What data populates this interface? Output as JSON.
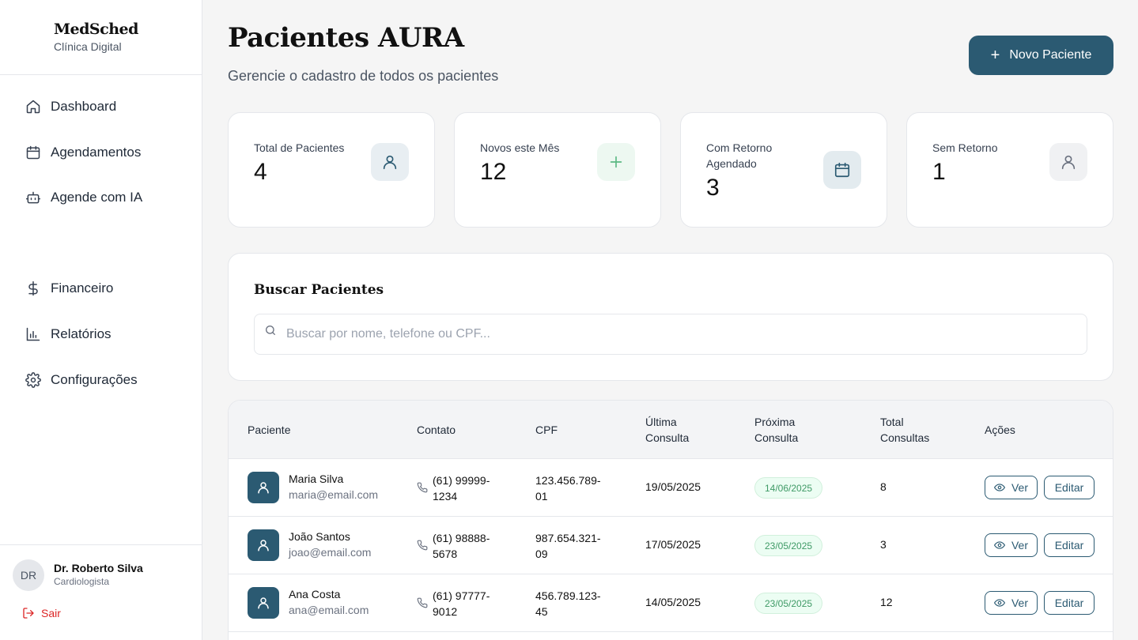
{
  "brand": {
    "name": "MedSched",
    "subtitle": "Clínica Digital"
  },
  "nav": {
    "items": [
      {
        "label": "Dashboard",
        "icon": "home-icon"
      },
      {
        "label": "Agendamentos",
        "icon": "calendar-icon"
      },
      {
        "label": "Agende com IA",
        "icon": "bot-icon"
      },
      {
        "label": "Financeiro",
        "icon": "dollar-icon"
      },
      {
        "label": "Relatórios",
        "icon": "bar-chart-icon"
      },
      {
        "label": "Configurações",
        "icon": "gear-icon"
      }
    ]
  },
  "user": {
    "initials": "DR",
    "name": "Dr. Roberto Silva",
    "role": "Cardiologista",
    "logout": "Sair"
  },
  "header": {
    "title": "Pacientes AURA",
    "subtitle": "Gerencie o cadastro de todos os pacientes",
    "new_button": "Novo Paciente"
  },
  "stats": [
    {
      "label": "Total de Pacientes",
      "value": "4",
      "icon": "user-icon"
    },
    {
      "label": "Novos este Mês",
      "value": "12",
      "icon": "plus-icon"
    },
    {
      "label": "Com Retorno Agendado",
      "value": "3",
      "icon": "calendar-icon"
    },
    {
      "label": "Sem Retorno",
      "value": "1",
      "icon": "user-icon"
    }
  ],
  "search": {
    "title": "Buscar Pacientes",
    "placeholder": "Buscar por nome, telefone ou CPF..."
  },
  "table": {
    "headers": {
      "paciente": "Paciente",
      "contato": "Contato",
      "cpf": "CPF",
      "ultima_1": "Última",
      "ultima_2": "Consulta",
      "proxima_1": "Próxima",
      "proxima_2": "Consulta",
      "total_1": "Total",
      "total_2": "Consultas",
      "acoes": "Ações"
    },
    "ver_label": "Ver",
    "edit_label": "Editar",
    "rows": [
      {
        "name": "Maria Silva",
        "email": "maria@email.com",
        "phone": "(61) 99999-1234",
        "cpf": "123.456.789-01",
        "ultima": "19/05/2025",
        "proxima": "14/06/2025",
        "total": "8"
      },
      {
        "name": "João Santos",
        "email": "joao@email.com",
        "phone": "(61) 98888-5678",
        "cpf": "987.654.321-09",
        "ultima": "17/05/2025",
        "proxima": "23/05/2025",
        "total": "3"
      },
      {
        "name": "Ana Costa",
        "email": "ana@email.com",
        "phone": "(61) 97777-9012",
        "cpf": "456.789.123-45",
        "ultima": "14/05/2025",
        "proxima": "23/05/2025",
        "total": "12"
      }
    ]
  },
  "colors": {
    "primary": "#2b5a72",
    "success": "#3f9a66",
    "danger": "#dc2626"
  }
}
